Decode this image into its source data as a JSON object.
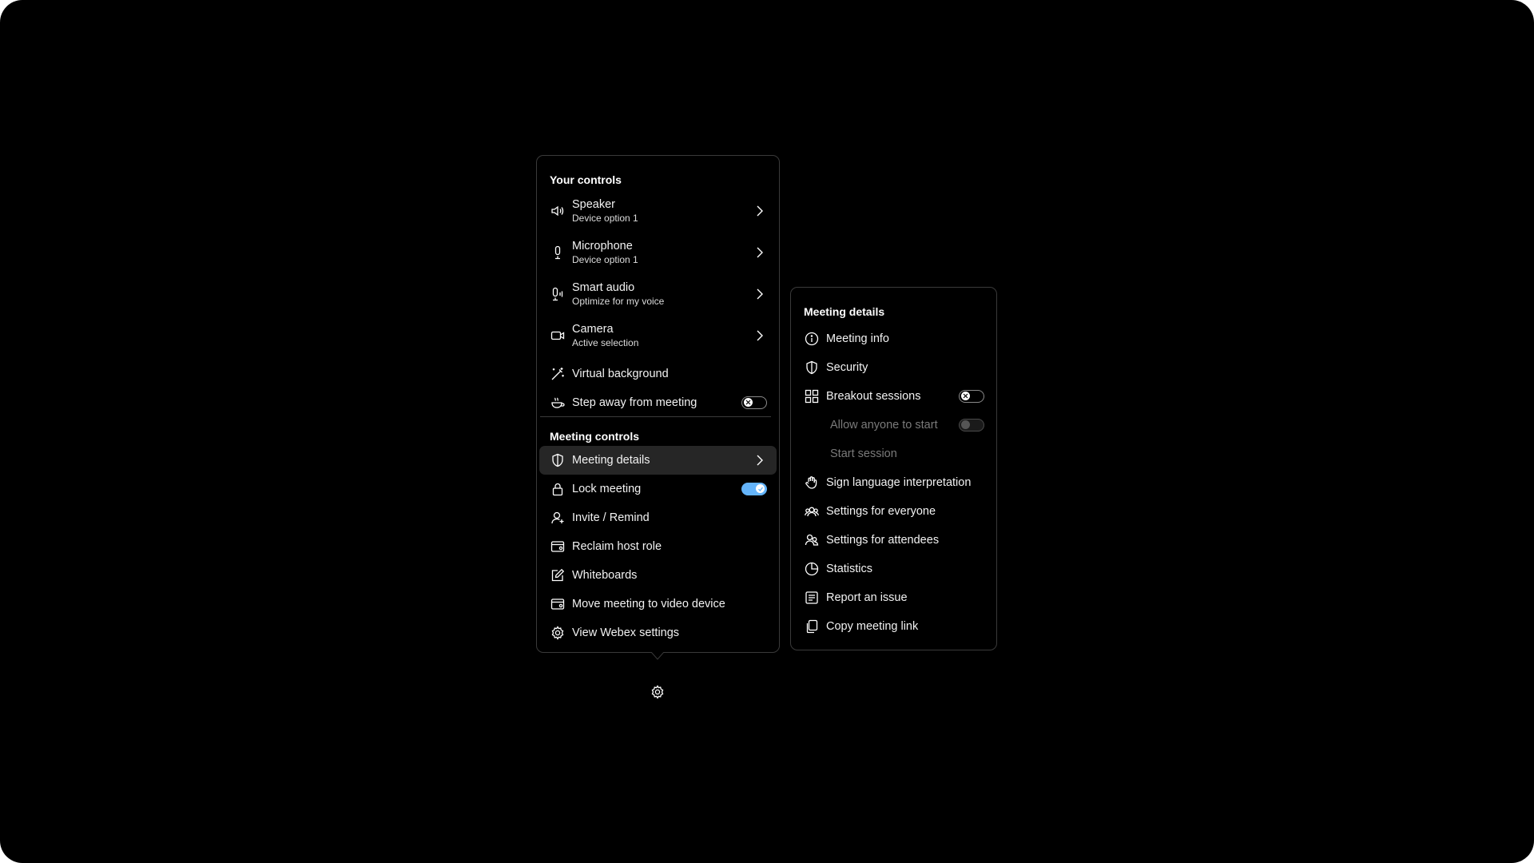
{
  "controls_panel": {
    "your_controls_title": "Your controls",
    "meeting_controls_title": "Meeting controls",
    "your_controls": [
      {
        "label": "Speaker",
        "sub": "Device option 1",
        "icon": "speaker-icon"
      },
      {
        "label": "Microphone",
        "sub": "Device option 1",
        "icon": "microphone-icon"
      },
      {
        "label": "Smart audio",
        "sub": "Optimize for my voice",
        "icon": "smart-audio-icon"
      },
      {
        "label": "Camera",
        "sub": "Active selection",
        "icon": "camera-icon"
      },
      {
        "label": "Virtual background",
        "icon": "magic-wand-icon"
      },
      {
        "label": "Step away from meeting",
        "icon": "coffee-cup-icon",
        "toggle": "off"
      }
    ],
    "meeting_controls": [
      {
        "label": "Meeting details",
        "icon": "shield-icon",
        "active": true
      },
      {
        "label": "Lock meeting",
        "icon": "lock-icon",
        "toggle": "on"
      },
      {
        "label": "Invite / Remind",
        "icon": "person-add-icon"
      },
      {
        "label": "Reclaim host role",
        "icon": "host-icon"
      },
      {
        "label": "Whiteboards",
        "icon": "whiteboard-icon"
      },
      {
        "label": "Move meeting to video device",
        "icon": "video-device-icon"
      },
      {
        "label": "View Webex settings",
        "icon": "gear-icon"
      }
    ]
  },
  "details_panel": {
    "title": "Meeting details",
    "items": [
      {
        "label": "Meeting info",
        "icon": "info-icon"
      },
      {
        "label": "Security",
        "icon": "shield-icon"
      },
      {
        "label": "Breakout sessions",
        "icon": "breakout-icon",
        "toggle": "off"
      },
      {
        "label": "Allow anyone to start",
        "disabled": true,
        "toggle": "disabled"
      },
      {
        "label": "Start session",
        "disabled": true
      },
      {
        "label": "Sign language interpretation",
        "icon": "sign-language-icon"
      },
      {
        "label": "Settings for everyone",
        "icon": "group-settings-icon"
      },
      {
        "label": "Settings for attendees",
        "icon": "attendees-icon"
      },
      {
        "label": "Statistics",
        "icon": "pie-chart-icon"
      },
      {
        "label": "Report an issue",
        "icon": "report-icon"
      },
      {
        "label": "Copy meeting link",
        "icon": "copy-icon"
      }
    ]
  },
  "colors": {
    "background": "#000000",
    "panel_border": "#3a3a3a",
    "active_row": "#262626",
    "toggle_on": "#64b4fa"
  },
  "footer": {
    "settings_icon": "gear-icon"
  }
}
